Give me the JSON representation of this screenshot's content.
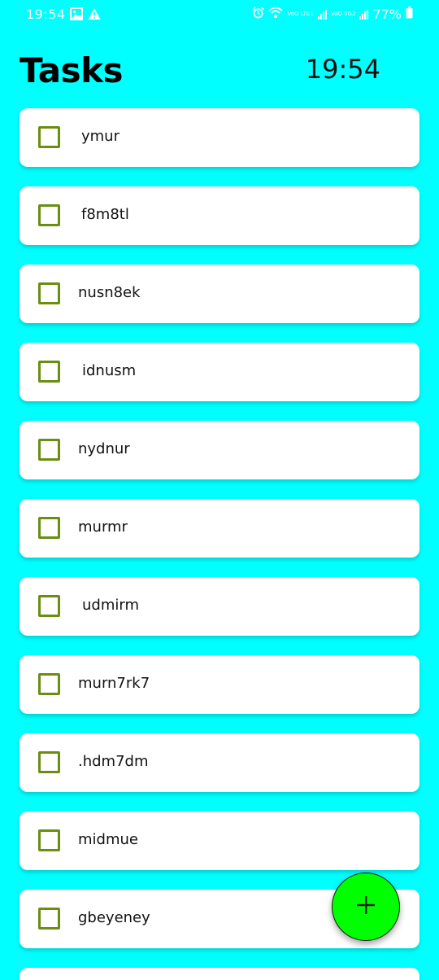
{
  "status_bar": {
    "time": "19:54",
    "network_1": "VoO LTE1",
    "network_2": "VoO 5G2",
    "battery": "77%",
    "icons": [
      "image-icon",
      "warning-icon",
      "alarm-icon",
      "wifi-icon",
      "signal-icon",
      "signal-icon",
      "battery-icon"
    ]
  },
  "header": {
    "title": "Tasks",
    "clock": "19:54"
  },
  "tasks": [
    {
      "label": "ymur",
      "checked": false
    },
    {
      "label": "f8m8tl",
      "checked": false
    },
    {
      "label": "nusn8ek",
      "checked": false
    },
    {
      "label": "idnusm",
      "checked": false
    },
    {
      "label": "nydnur",
      "checked": false
    },
    {
      "label": "murmr",
      "checked": false
    },
    {
      "label": "udmirm",
      "checked": false
    },
    {
      "label": "murn7rk7",
      "checked": false
    },
    {
      "label": ".hdm7dm",
      "checked": false
    },
    {
      "label": "midmue",
      "checked": false
    },
    {
      "label": "gbeyeney",
      "checked": false
    },
    {
      "label": "",
      "checked": false
    }
  ],
  "fab": {
    "icon": "plus-icon"
  },
  "colors": {
    "background": "#00FFFF",
    "card": "#FFFFFF",
    "checkbox_border": "#6B8E12",
    "fab": "#00FF00"
  }
}
